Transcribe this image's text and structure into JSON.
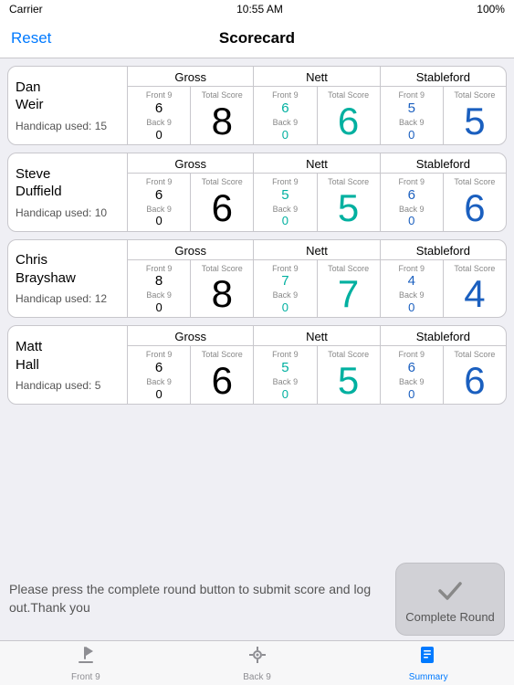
{
  "statusBar": {
    "carrier": "Carrier",
    "wifi": "wifi",
    "time": "10:55 AM",
    "battery": "100%"
  },
  "navBar": {
    "resetLabel": "Reset",
    "title": "Scorecard"
  },
  "players": [
    {
      "firstName": "Dan",
      "lastName": "Weir",
      "handicap": "Handicap used: 15",
      "gross": {
        "header": "Gross",
        "front9Label": "Front 9",
        "front9Value": "6",
        "totalScoreLabel": "Total Score",
        "totalValue": "8",
        "back9Label": "Back 9",
        "back9Value": "0"
      },
      "nett": {
        "header": "Nett",
        "front9Label": "Front 9",
        "front9Value": "6",
        "totalScoreLabel": "Total Score",
        "totalValue": "6",
        "back9Label": "Back 9",
        "back9Value": "0"
      },
      "stableford": {
        "header": "Stableford",
        "front9Label": "Front 9",
        "front9Value": "5",
        "totalScoreLabel": "Total Score",
        "totalValue": "5",
        "back9Label": "Back 9",
        "back9Value": "0"
      }
    },
    {
      "firstName": "Steve",
      "lastName": "Duffield",
      "handicap": "Handicap used: 10",
      "gross": {
        "header": "Gross",
        "front9Label": "Front 9",
        "front9Value": "6",
        "totalScoreLabel": "Total Score",
        "totalValue": "6",
        "back9Label": "Back 9",
        "back9Value": "0"
      },
      "nett": {
        "header": "Nett",
        "front9Label": "Front 9",
        "front9Value": "5",
        "totalScoreLabel": "Total Score",
        "totalValue": "5",
        "back9Label": "Back 9",
        "back9Value": "0"
      },
      "stableford": {
        "header": "Stableford",
        "front9Label": "Front 9",
        "front9Value": "6",
        "totalScoreLabel": "Total Score",
        "totalValue": "6",
        "back9Label": "Back 9",
        "back9Value": "0"
      }
    },
    {
      "firstName": "Chris",
      "lastName": "Brayshaw",
      "handicap": "Handicap used: 12",
      "gross": {
        "header": "Gross",
        "front9Label": "Front 9",
        "front9Value": "8",
        "totalScoreLabel": "Total Score",
        "totalValue": "8",
        "back9Label": "Back 9",
        "back9Value": "0"
      },
      "nett": {
        "header": "Nett",
        "front9Label": "Front 9",
        "front9Value": "7",
        "totalScoreLabel": "Total Score",
        "totalValue": "7",
        "back9Label": "Back 9",
        "back9Value": "0"
      },
      "stableford": {
        "header": "Stableford",
        "front9Label": "Front 9",
        "front9Value": "4",
        "totalScoreLabel": "Total Score",
        "totalValue": "4",
        "back9Label": "Back 9",
        "back9Value": "0"
      }
    },
    {
      "firstName": "Matt",
      "lastName": "Hall",
      "handicap": "Handicap used: 5",
      "gross": {
        "header": "Gross",
        "front9Label": "Front 9",
        "front9Value": "6",
        "totalScoreLabel": "Total Score",
        "totalValue": "6",
        "back9Label": "Back 9",
        "back9Value": "0"
      },
      "nett": {
        "header": "Nett",
        "front9Label": "Front 9",
        "front9Value": "5",
        "totalScoreLabel": "Total Score",
        "totalValue": "5",
        "back9Label": "Back 9",
        "back9Value": "0"
      },
      "stableford": {
        "header": "Stableford",
        "front9Label": "Front 9",
        "front9Value": "6",
        "totalScoreLabel": "Total Score",
        "totalValue": "6",
        "back9Label": "Back 9",
        "back9Value": "0"
      }
    }
  ],
  "bottomSection": {
    "text": "Please press the complete round button to submit score and log out.Thank you",
    "buttonLabel": "Complete Round"
  },
  "tabBar": {
    "tabs": [
      {
        "label": "Front 9",
        "icon": "⛳",
        "active": false
      },
      {
        "label": "Back 9",
        "icon": "📍",
        "active": false
      },
      {
        "label": "Summary",
        "icon": "📋",
        "active": true
      }
    ]
  }
}
